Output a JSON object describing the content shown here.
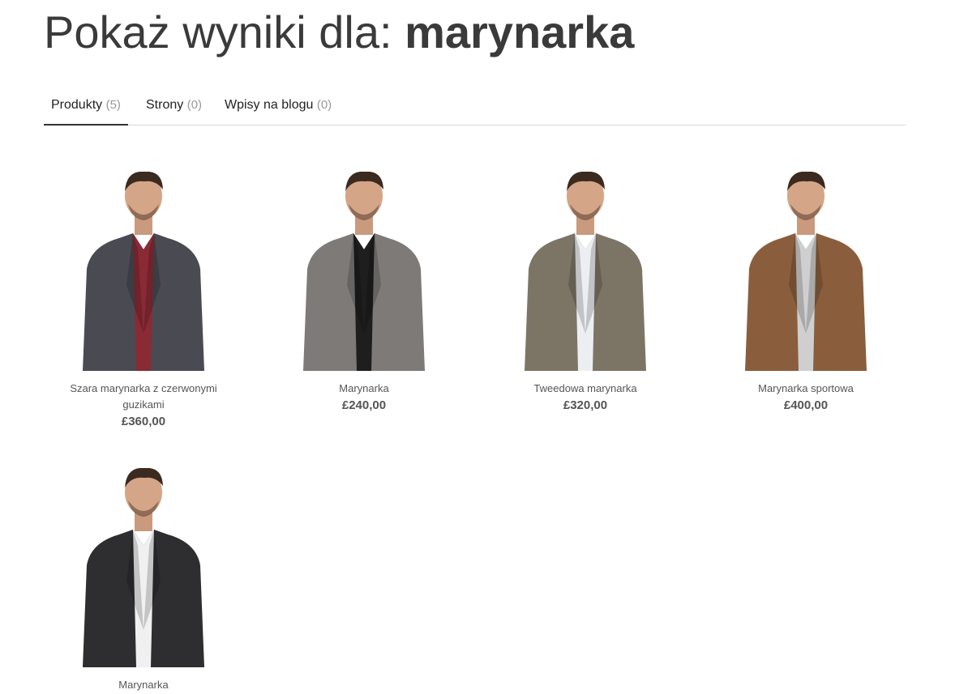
{
  "search": {
    "prefix": "Pokaż wyniki dla: ",
    "term": "marynarka"
  },
  "tabs": [
    {
      "label": "Produkty",
      "count": "(5)",
      "active": true
    },
    {
      "label": "Strony",
      "count": "(0)",
      "active": false
    },
    {
      "label": "Wpisy na blogu",
      "count": "(0)",
      "active": false
    }
  ],
  "products": [
    {
      "name": "Szara marynarka z czerwonymi guzikami",
      "price": "£360,00",
      "jacket_color": "#4a4a52",
      "accent": "#8a2a35"
    },
    {
      "name": "Marynarka",
      "price": "£240,00",
      "jacket_color": "#7d7a78",
      "accent": "#1e1e1e"
    },
    {
      "name": "Tweedowa marynarka",
      "price": "£320,00",
      "jacket_color": "#7c7566",
      "accent": "#eceef2"
    },
    {
      "name": "Marynarka sportowa",
      "price": "£400,00",
      "jacket_color": "#8a5e3c",
      "accent": "#cfcfcf"
    },
    {
      "name": "Marynarka",
      "price": "",
      "jacket_color": "#2e2e30",
      "accent": "#f0f0f0"
    }
  ]
}
